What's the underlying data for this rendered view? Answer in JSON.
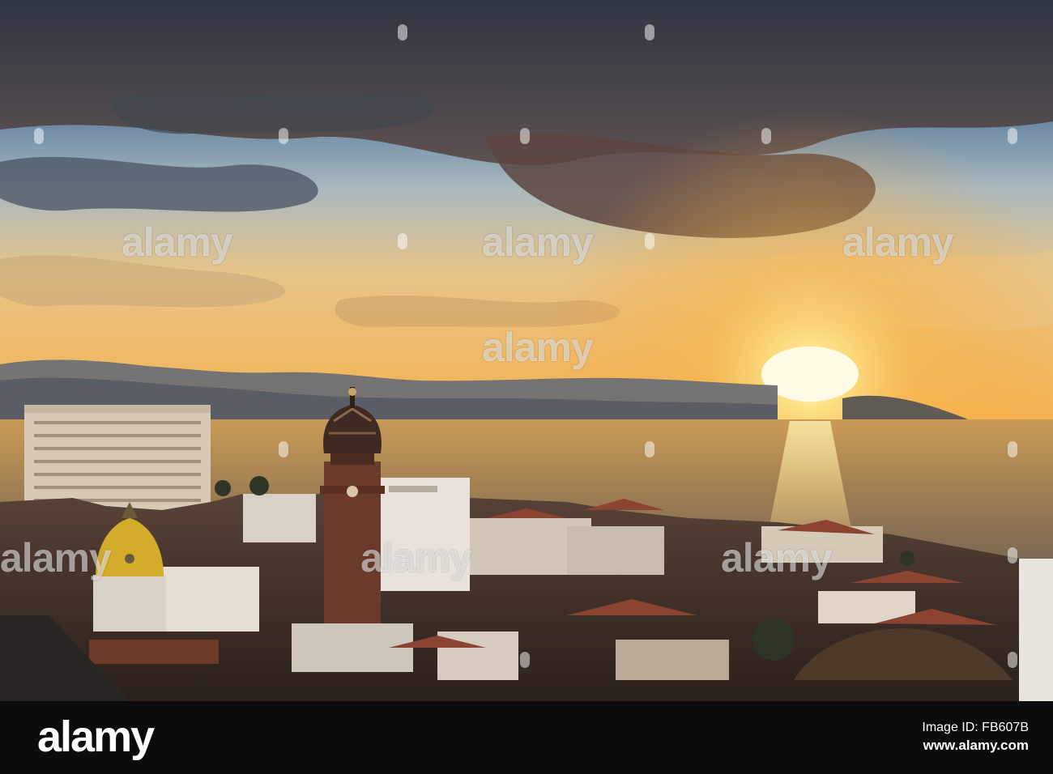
{
  "scene": {
    "subject": "sunset-over-coastal-town-with-cathedral-crown-tower",
    "colors": {
      "sky_top": "#3b4e68",
      "sky_mid": "#7fa3c4",
      "sky_warm": "#f3c16a",
      "sun": "#fff3c4",
      "sea": "#b9894a",
      "sea_glitter": "#ffe09a",
      "mountains": "#6a6b6f",
      "town_shadow": "#3a2c25",
      "roof": "#7a3d2a",
      "dome_gold": "#d8b32a"
    }
  },
  "watermark": {
    "logo": "alamy",
    "repeats_per_row": 6
  },
  "footer": {
    "logo": "alamy",
    "image_id_label": "Image ID: FB607B",
    "website": "www.alamy.com"
  }
}
